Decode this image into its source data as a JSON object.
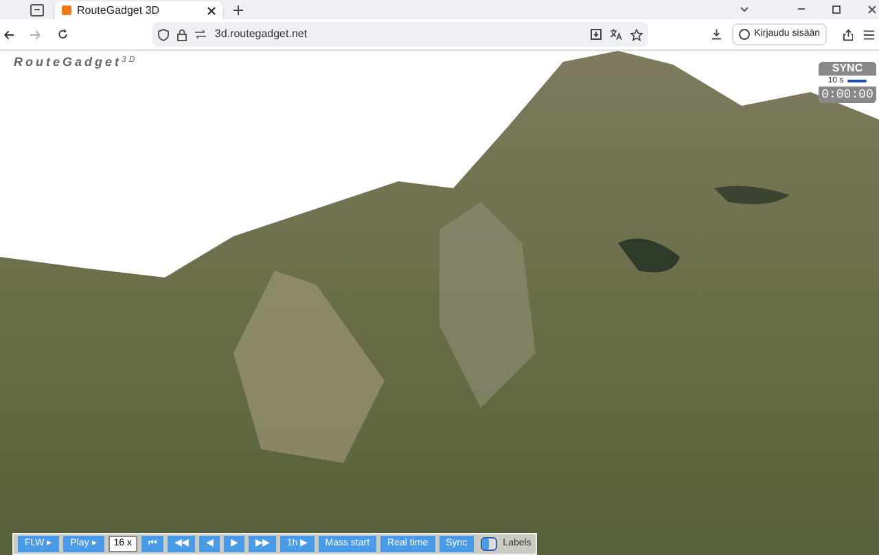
{
  "browser": {
    "tab_title": "RouteGadget 3D",
    "url": "3d.routegadget.net",
    "sign_in": "Kirjaudu sisään"
  },
  "app": {
    "logo": "RouteGadget",
    "logo_sup": "3D"
  },
  "sync_panel": {
    "title": "SYNC",
    "interval": "10 s",
    "clock": "0:00:00"
  },
  "toolbar": [
    {
      "kind": "button",
      "label": "FLW ▸"
    },
    {
      "kind": "button",
      "label": "Play ▸"
    },
    {
      "kind": "select",
      "label": "16 x"
    },
    {
      "kind": "button",
      "label": "⏮"
    },
    {
      "kind": "button",
      "label": "◀◀"
    },
    {
      "kind": "button",
      "label": "◀"
    },
    {
      "kind": "button",
      "label": "▶"
    },
    {
      "kind": "button",
      "label": "▶▶"
    },
    {
      "kind": "button",
      "label": "1h ▶"
    },
    {
      "kind": "button",
      "label": "Mass start"
    },
    {
      "kind": "button",
      "label": "Real time"
    },
    {
      "kind": "button",
      "label": "Sync"
    },
    {
      "kind": "toggle",
      "label": "Labels",
      "on": false
    }
  ]
}
